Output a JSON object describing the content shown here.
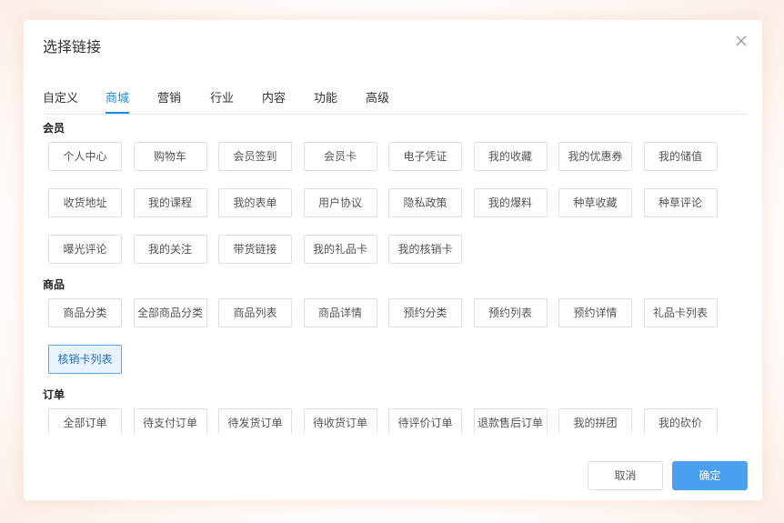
{
  "dialog": {
    "title": "选择链接",
    "cancel_label": "取消",
    "confirm_label": "确定",
    "colors": {
      "accent": "#1e88e5",
      "primary_button": "#4a9ff0"
    }
  },
  "tabs": [
    "自定义",
    "商城",
    "营销",
    "行业",
    "内容",
    "功能",
    "高级"
  ],
  "active_tab": "商城",
  "sections": [
    {
      "title": "会员",
      "items": [
        "个人中心",
        "购物车",
        "会员签到",
        "会员卡",
        "电子凭证",
        "我的收藏",
        "我的优惠券",
        "我的储值",
        "收货地址",
        "我的课程",
        "我的表单",
        "用户协议",
        "隐私政策",
        "我的爆料",
        "种草收藏",
        "种草评论",
        "曝光评论",
        "我的关注",
        "带货链接",
        "我的礼品卡",
        "我的核销卡"
      ]
    },
    {
      "title": "商品",
      "items": [
        "商品分类",
        "全部商品分类",
        "商品列表",
        "商品详情",
        "预约分类",
        "预约列表",
        "预约详情",
        "礼品卡列表",
        "核销卡列表"
      ]
    },
    {
      "title": "订单",
      "items": [
        "全部订单",
        "待支付订单",
        "待发货订单",
        "待收货订单",
        "待评价订单",
        "退款售后订单",
        "我的拼团",
        "我的砍价"
      ]
    }
  ],
  "selected_item": "核销卡列表",
  "icons": {
    "close": "close-icon"
  }
}
